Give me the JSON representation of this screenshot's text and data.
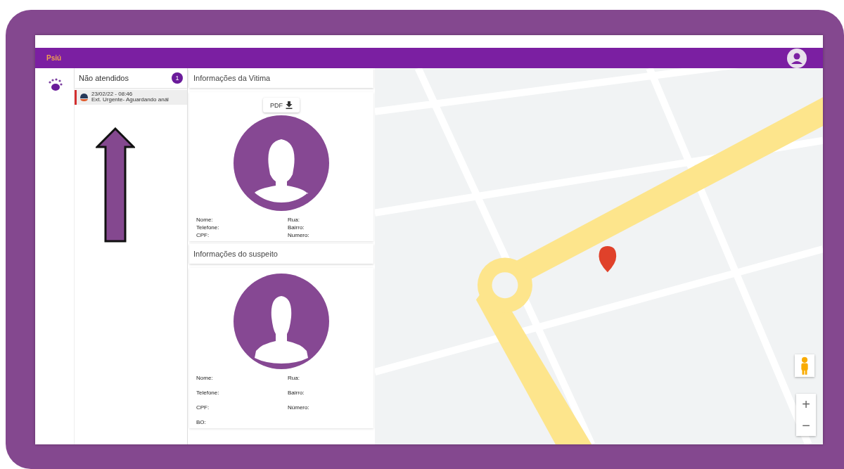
{
  "app": {
    "logo": "Psiú"
  },
  "queue": {
    "title": "Não atendidos",
    "count": "1",
    "items": [
      {
        "date": "23/02/22 - 08:46",
        "status": "Ext. Urgente- Aguardando anál",
        "color": "#d32f2f",
        "selected": true
      }
    ]
  },
  "victim": {
    "title": "Informações da Vitima",
    "pdf_button": "PDF",
    "fields": [
      {
        "label": "Nome:"
      },
      {
        "label": "Rua:"
      },
      {
        "label": "Telefone:"
      },
      {
        "label": "Bairro:"
      },
      {
        "label": "CPF:"
      },
      {
        "label": "Numero:"
      }
    ]
  },
  "suspect": {
    "title": "Informações do suspeito",
    "fields": [
      {
        "label": "Nome:"
      },
      {
        "label": "Rua:"
      },
      {
        "label": "Telefone:"
      },
      {
        "label": "Bairro:"
      },
      {
        "label": "CPF:"
      },
      {
        "label": "Número:"
      },
      {
        "label": "BO:"
      }
    ]
  },
  "map": {
    "zoom_in": "+",
    "zoom_out": "−"
  }
}
